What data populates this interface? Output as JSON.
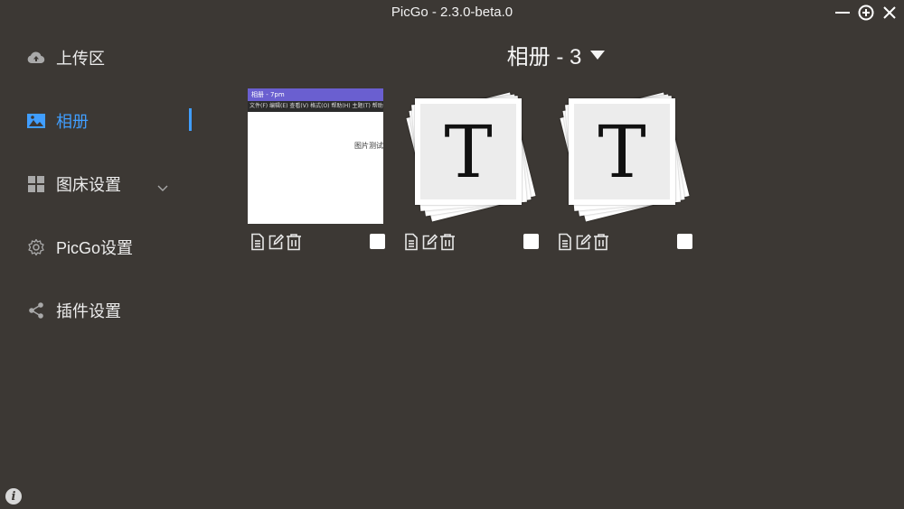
{
  "window": {
    "title": "PicGo - 2.3.0-beta.0"
  },
  "sidebar": {
    "items": [
      {
        "label": "上传区",
        "icon": "cloud-upload-icon"
      },
      {
        "label": "相册",
        "icon": "image-icon",
        "active": true
      },
      {
        "label": "图床设置",
        "icon": "grid-icon"
      },
      {
        "label": "PicGo设置",
        "icon": "gear-icon"
      },
      {
        "label": "插件设置",
        "icon": "share-icon"
      }
    ]
  },
  "gallery": {
    "title": "相册 - 3",
    "items": [
      {
        "type": "screenshot",
        "titlebar_text": "相册 - 7pm",
        "menubar_text": "文件(F)  编辑(E)  查看(V)  格式(O)  帮助(H)  主题(T)  帮助(H)",
        "content_text": "图片测试",
        "checked": false
      },
      {
        "type": "text-icon",
        "glyph": "T",
        "checked": false
      },
      {
        "type": "text-icon",
        "glyph": "T",
        "checked": false
      }
    ]
  },
  "colors": {
    "background": "#3c3834",
    "accent": "#409eff"
  }
}
